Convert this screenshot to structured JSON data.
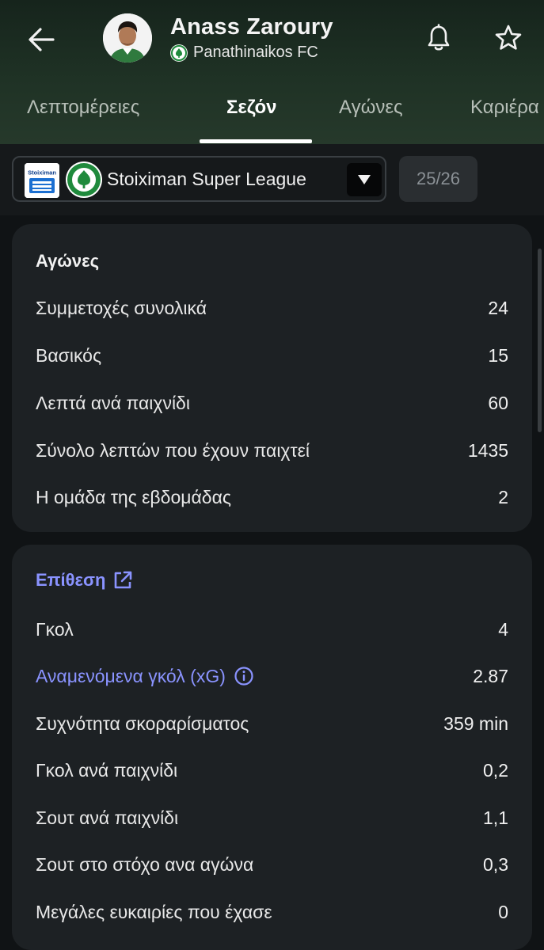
{
  "header": {
    "player_name": "Anass Zaroury",
    "club_name": "Panathinaikos FC",
    "icons": {
      "back": "arrow-left-icon",
      "bell": "bell-icon",
      "star": "star-icon"
    }
  },
  "tabs": [
    {
      "label": "Λεπτομέρειες"
    },
    {
      "label": "Σεζόν"
    },
    {
      "label": "Αγώνες"
    },
    {
      "label": "Καριέρα"
    }
  ],
  "active_tab": "Σεζόν",
  "filter": {
    "league_logo_text": "Stoiximan",
    "league": "Stoiximan Super League",
    "season": "25/26"
  },
  "matches": {
    "title": "Αγώνες",
    "rows": [
      {
        "label": "Συμμετοχές συνολικά",
        "value": "24"
      },
      {
        "label": "Βασικός",
        "value": "15"
      },
      {
        "label": "Λεπτά ανά παιχνίδι",
        "value": "60"
      },
      {
        "label": "Σύνολο λεπτών που έχουν παιχτεί",
        "value": "1435"
      },
      {
        "label": "Η ομάδα της εβδομάδας",
        "value": "2"
      }
    ]
  },
  "attack": {
    "title": "Επίθεση",
    "rows": [
      {
        "label": "Γκολ",
        "value": "4"
      },
      {
        "label": "Αναμενόμενα γκόλ (xG)",
        "value": "2.87"
      },
      {
        "label": "Συχνότητα σκοραρίσματος",
        "value": "359 min"
      },
      {
        "label": "Γκολ ανά παιχνίδι",
        "value": "0,2"
      },
      {
        "label": "Σουτ ανά παιχνίδι",
        "value": "1,1"
      },
      {
        "label": "Σουτ στο στόχο ανα αγώνα",
        "value": "0,3"
      },
      {
        "label": "Μεγάλες ευκαιρίες που έχασε",
        "value": "0"
      }
    ]
  },
  "colors": {
    "accent": "#8a93ff",
    "card": "#1d2124",
    "background": "#101315",
    "header": "#1f3225",
    "club_green": "#1f8a3c"
  }
}
